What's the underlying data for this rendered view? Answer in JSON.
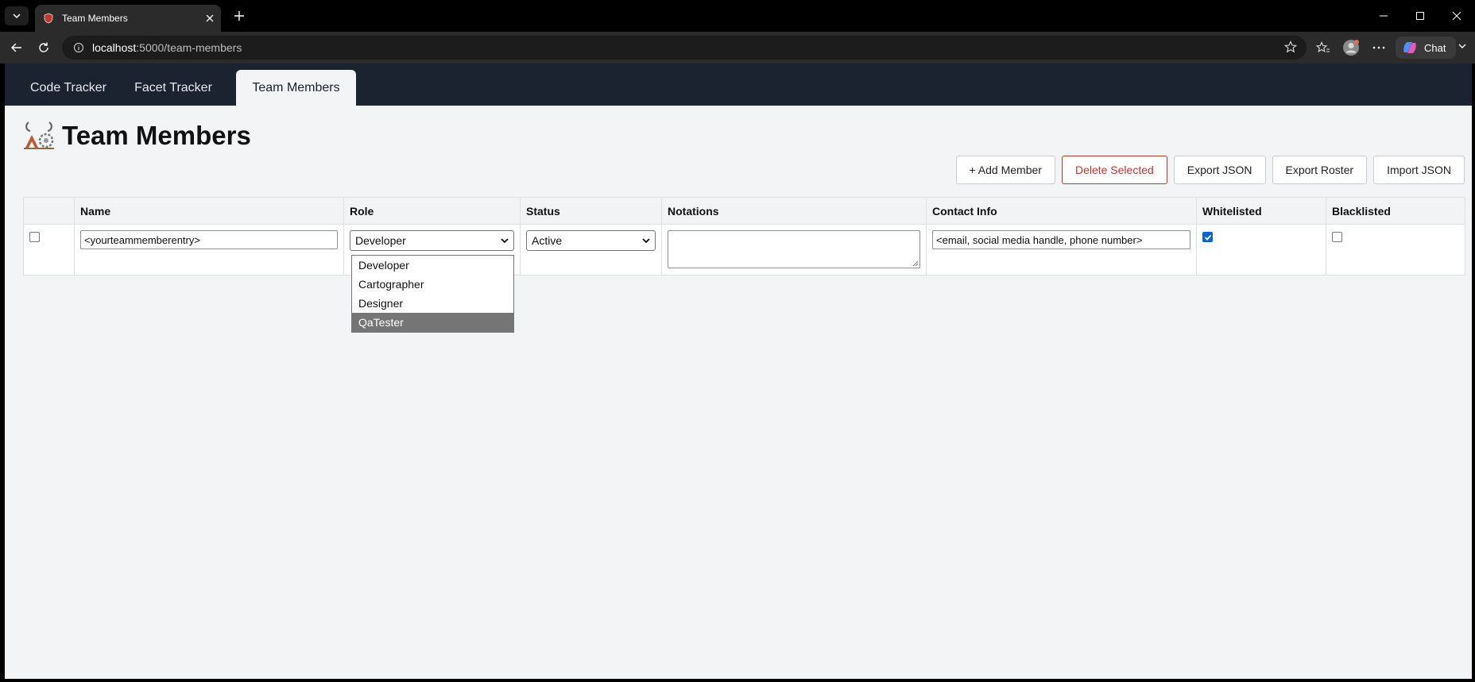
{
  "browser": {
    "tab_title": "Team Members",
    "url_host": "localhost",
    "url_path": ":5000/team-members",
    "chat_label": "Chat"
  },
  "app": {
    "tabs": [
      {
        "label": "Code Tracker"
      },
      {
        "label": "Facet Tracker"
      },
      {
        "label": "Team Members"
      }
    ],
    "active_tab": "Team Members",
    "page_title": "Team Members",
    "actions": {
      "add": "+ Add Member",
      "delete": "Delete Selected",
      "export_json": "Export JSON",
      "export_roster": "Export Roster",
      "import_json": "Import JSON"
    },
    "table": {
      "headers": [
        "",
        "Name",
        "Role",
        "Status",
        "Notations",
        "Contact Info",
        "Whitelisted",
        "Blacklisted"
      ],
      "row": {
        "selected": false,
        "name": "<yourteammemberentry>",
        "role": "Developer",
        "status": "Active",
        "notations": "",
        "contact": "<email, social media handle, phone number>",
        "whitelisted": true,
        "blacklisted": false
      }
    },
    "role_dropdown": {
      "options": [
        "Developer",
        "Cartographer",
        "Designer",
        "QaTester"
      ],
      "highlighted": "QaTester"
    }
  },
  "colors": {
    "nav_bg": "#1b2330",
    "page_bg": "#f2f4f6",
    "danger": "#c0392b",
    "checkbox_accent": "#0a64d8"
  }
}
